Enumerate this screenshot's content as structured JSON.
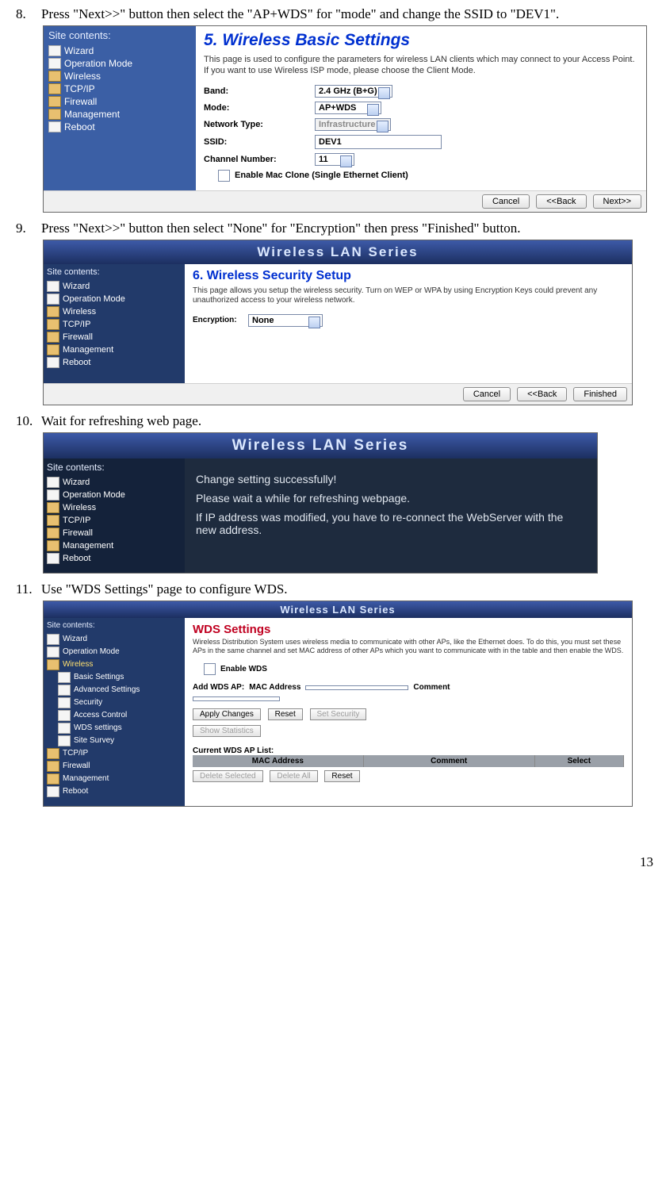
{
  "steps": {
    "s8": {
      "num": "8.",
      "text": "Press \"Next>>\" button then select the \"AP+WDS\" for \"mode\" and change the SSID to \"DEV1\"."
    },
    "s9": {
      "num": "9.",
      "text": "Press \"Next>>\" button then select \"None\" for \"Encryption\" then press \"Finished\" button."
    },
    "s10": {
      "num": "10.",
      "text": "Wait for refreshing web page."
    },
    "s11": {
      "num": "11.",
      "text": "Use \"WDS Settings\" page to configure WDS."
    }
  },
  "sidebar": {
    "title": "Site contents:",
    "items": [
      "Wizard",
      "Operation Mode",
      "Wireless",
      "TCP/IP",
      "Firewall",
      "Management",
      "Reboot"
    ],
    "wireless_sub": [
      "Basic Settings",
      "Advanced Settings",
      "Security",
      "Access Control",
      "WDS settings",
      "Site Survey"
    ]
  },
  "shot1": {
    "heading": "5. Wireless Basic Settings",
    "desc": "This page is used to configure the parameters for wireless LAN clients which may connect to your Access Point. If you want to use Wireless ISP mode, please choose the Client Mode.",
    "labels": {
      "band": "Band:",
      "mode": "Mode:",
      "ntype": "Network Type:",
      "ssid": "SSID:",
      "chan": "Channel Number:"
    },
    "values": {
      "band": "2.4 GHz (B+G)",
      "mode": "AP+WDS",
      "ntype": "Infrastructure",
      "ssid": "DEV1",
      "chan": "11"
    },
    "mac_clone": "Enable Mac Clone (Single Ethernet Client)",
    "buttons": {
      "cancel": "Cancel",
      "back": "<<Back",
      "next": "Next>>"
    }
  },
  "banner": "Wireless LAN Series",
  "shot2": {
    "heading": "6. Wireless Security Setup",
    "desc": "This page allows you setup the wireless security. Turn on WEP or WPA by using Encryption Keys could prevent any unauthorized access to your wireless network.",
    "enc_label": "Encryption:",
    "enc_value": "None",
    "buttons": {
      "cancel": "Cancel",
      "back": "<<Back",
      "finish": "Finished"
    }
  },
  "shot3": {
    "l1": "Change setting successfully!",
    "l2": "Please wait a while for refreshing webpage.",
    "l3": "If IP address was modified, you have to re-connect the WebServer with the new address."
  },
  "shot4": {
    "heading": "WDS Settings",
    "desc": "Wireless Distribution System uses wireless media to communicate with other APs, like the Ethernet does. To do this, you must set these APs in the same channel and set MAC address of other APs which you want to communicate with in the table and then enable the WDS.",
    "enable": "Enable WDS",
    "add_label": "Add WDS AP:",
    "mac_label": "MAC Address",
    "comment_label": "Comment",
    "buttons": {
      "apply": "Apply Changes",
      "reset": "Reset",
      "setsec": "Set Security",
      "showstat": "Show Statistics",
      "delsel": "Delete Selected",
      "delall": "Delete All",
      "reset2": "Reset"
    },
    "list_title": "Current WDS AP List:",
    "cols": {
      "mac": "MAC Address",
      "comment": "Comment",
      "select": "Select"
    }
  },
  "page_number": "13"
}
